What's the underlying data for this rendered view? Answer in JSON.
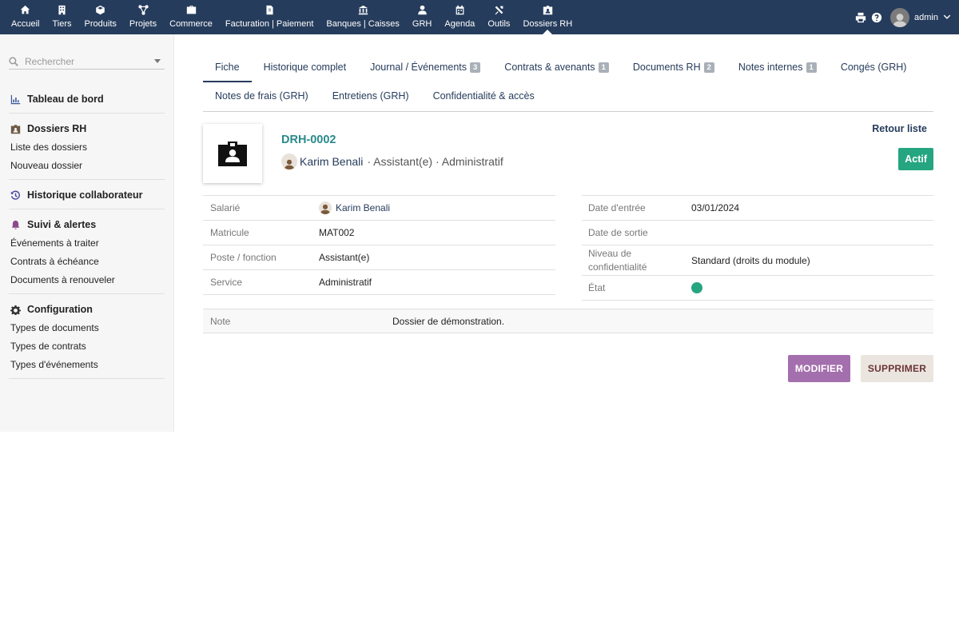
{
  "topmenu": [
    {
      "label": "Accueil",
      "icon": "home-icon"
    },
    {
      "label": "Tiers",
      "icon": "building-icon"
    },
    {
      "label": "Produits",
      "icon": "cube-icon"
    },
    {
      "label": "Projets",
      "icon": "project-icon"
    },
    {
      "label": "Commerce",
      "icon": "briefcase-icon"
    },
    {
      "label": "Facturation | Paiement",
      "icon": "invoice-icon"
    },
    {
      "label": "Banques | Caisses",
      "icon": "bank-icon"
    },
    {
      "label": "GRH",
      "icon": "user-icon"
    },
    {
      "label": "Agenda",
      "icon": "calendar-icon"
    },
    {
      "label": "Outils",
      "icon": "tools-icon"
    },
    {
      "label": "Dossiers RH",
      "icon": "id-badge-icon"
    }
  ],
  "user": {
    "name": "admin"
  },
  "sidebar": {
    "search_placeholder": "Rechercher",
    "sections": [
      {
        "title": "Tableau de bord",
        "icon": "chart-icon",
        "links": []
      },
      {
        "title": "Dossiers RH",
        "icon": "id-badge-icon",
        "links": [
          "Liste des dossiers",
          "Nouveau dossier"
        ]
      },
      {
        "title": "Historique collaborateur",
        "icon": "history-icon",
        "links": []
      },
      {
        "title": "Suivi & alertes",
        "icon": "bell-icon",
        "links": [
          "Événements à traiter",
          "Contrats à échéance",
          "Documents à renouveler"
        ]
      },
      {
        "title": "Configuration",
        "icon": "gear-icon",
        "links": [
          "Types de documents",
          "Types de contrats",
          "Types d'événements"
        ]
      }
    ]
  },
  "tabs_row1": [
    {
      "label": "Fiche",
      "badge": ""
    },
    {
      "label": "Historique complet",
      "badge": ""
    },
    {
      "label": "Journal / Événements",
      "badge": "3"
    },
    {
      "label": "Contrats & avenants",
      "badge": "1"
    },
    {
      "label": "Documents RH",
      "badge": "2"
    },
    {
      "label": "Notes internes",
      "badge": "1"
    },
    {
      "label": "Congés (GRH)",
      "badge": ""
    }
  ],
  "tabs_row2": [
    {
      "label": "Notes de frais (GRH)"
    },
    {
      "label": "Entretiens (GRH)"
    },
    {
      "label": "Confidentialité & accès"
    }
  ],
  "record": {
    "ref": "DRH-0002",
    "employee": "Karim Benali",
    "subtitle": "· Assistant(e) · Administratif",
    "back_label": "Retour liste",
    "status": "Actif"
  },
  "fields_left": [
    {
      "label": "Salarié",
      "value": "Karim Benali"
    },
    {
      "label": "Matricule",
      "value": "MAT002"
    },
    {
      "label": "Poste / fonction",
      "value": "Assistant(e)"
    },
    {
      "label": "Service",
      "value": "Administratif"
    }
  ],
  "fields_right": [
    {
      "label": "Date d'entrée",
      "value": "03/01/2024"
    },
    {
      "label": "Date de sortie",
      "value": ""
    },
    {
      "label": "Niveau de confidentialité",
      "value": "Standard (droits du module)"
    },
    {
      "label": "État",
      "value": ""
    }
  ],
  "note": {
    "label": "Note",
    "value": "Dossier de démonstration."
  },
  "actions": {
    "edit": "MODIFIER",
    "delete": "SUPPRIMER"
  },
  "colors": {
    "topbar": "#263c5c",
    "status": "#25a580",
    "edit": "#a46fad",
    "link": "#263c5c",
    "ref": "#2a8a8a"
  }
}
